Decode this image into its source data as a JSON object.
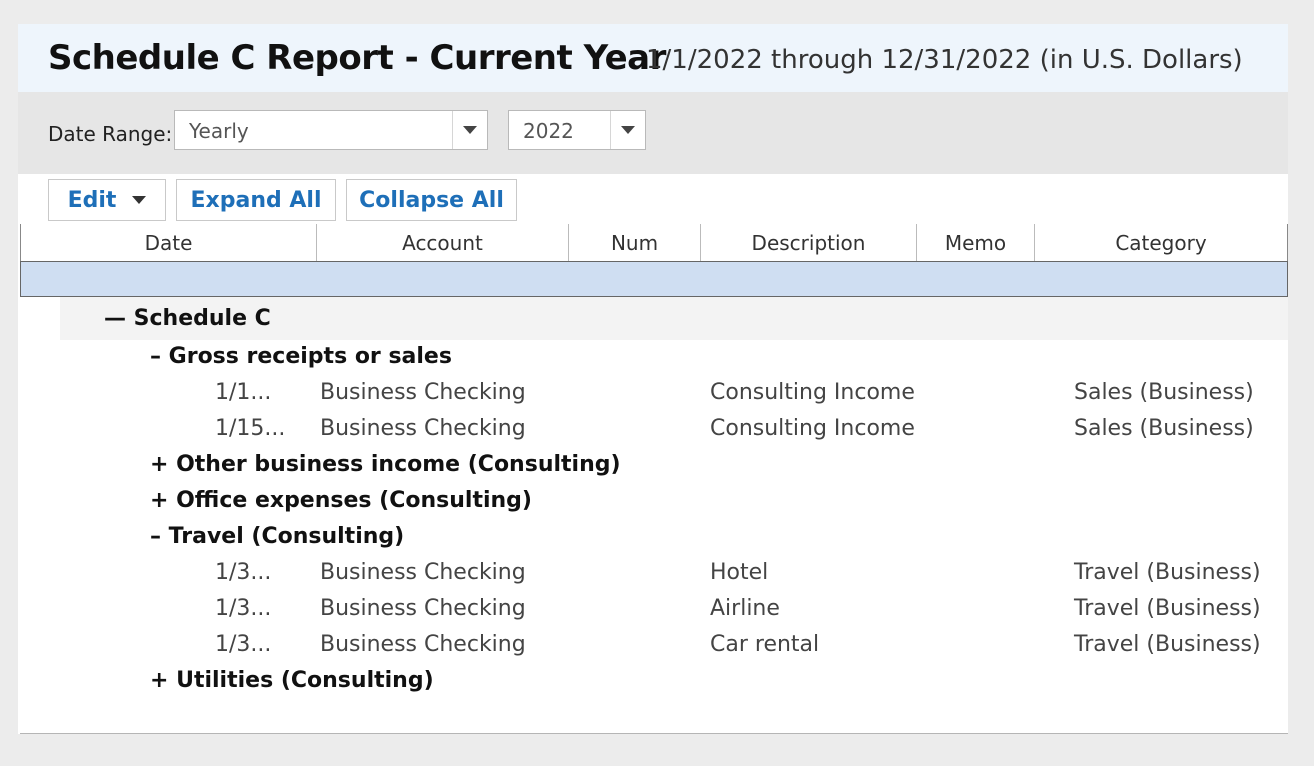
{
  "report": {
    "title": "Schedule C Report - Current Year",
    "subtitle": "1/1/2022 through 12/31/2022 (in U.S. Dollars)"
  },
  "filters": {
    "date_range_label": "Date Range:",
    "period_value": "Yearly",
    "year_value": "2022"
  },
  "toolbar": {
    "edit_label": "Edit",
    "expand_all_label": "Expand All",
    "collapse_all_label": "Collapse All"
  },
  "columns": [
    "Date",
    "Account",
    "Num",
    "Description",
    "Memo",
    "Category"
  ],
  "tree": {
    "root_label": "— Schedule C",
    "groups": [
      {
        "label": "– Gross receipts or sales",
        "rows": [
          {
            "date": "1/1...",
            "account": "Business Checking",
            "num": "",
            "description": "Consulting Income",
            "memo": "",
            "category": "Sales (Business)"
          },
          {
            "date": "1/15...",
            "account": "Business Checking",
            "num": "",
            "description": "Consulting Income",
            "memo": "",
            "category": "Sales (Business)"
          }
        ]
      },
      {
        "label": "+ Other business income (Consulting)",
        "rows": []
      },
      {
        "label": "+ Office expenses (Consulting)",
        "rows": []
      },
      {
        "label": "– Travel (Consulting)",
        "rows": [
          {
            "date": "1/3...",
            "account": "Business Checking",
            "num": "",
            "description": "Hotel",
            "memo": "",
            "category": "Travel (Business)"
          },
          {
            "date": "1/3...",
            "account": "Business Checking",
            "num": "",
            "description": "Airline",
            "memo": "",
            "category": "Travel (Business)"
          },
          {
            "date": "1/3...",
            "account": "Business Checking",
            "num": "",
            "description": "Car rental",
            "memo": "",
            "category": "Travel (Business)"
          }
        ]
      },
      {
        "label": "+ Utilities (Consulting)",
        "rows": []
      }
    ]
  },
  "colors": {
    "accent": "#1e6fb8",
    "selection": "#cfdef2",
    "title_band": "#eef5fc",
    "filter_band": "#e6e6e6"
  }
}
